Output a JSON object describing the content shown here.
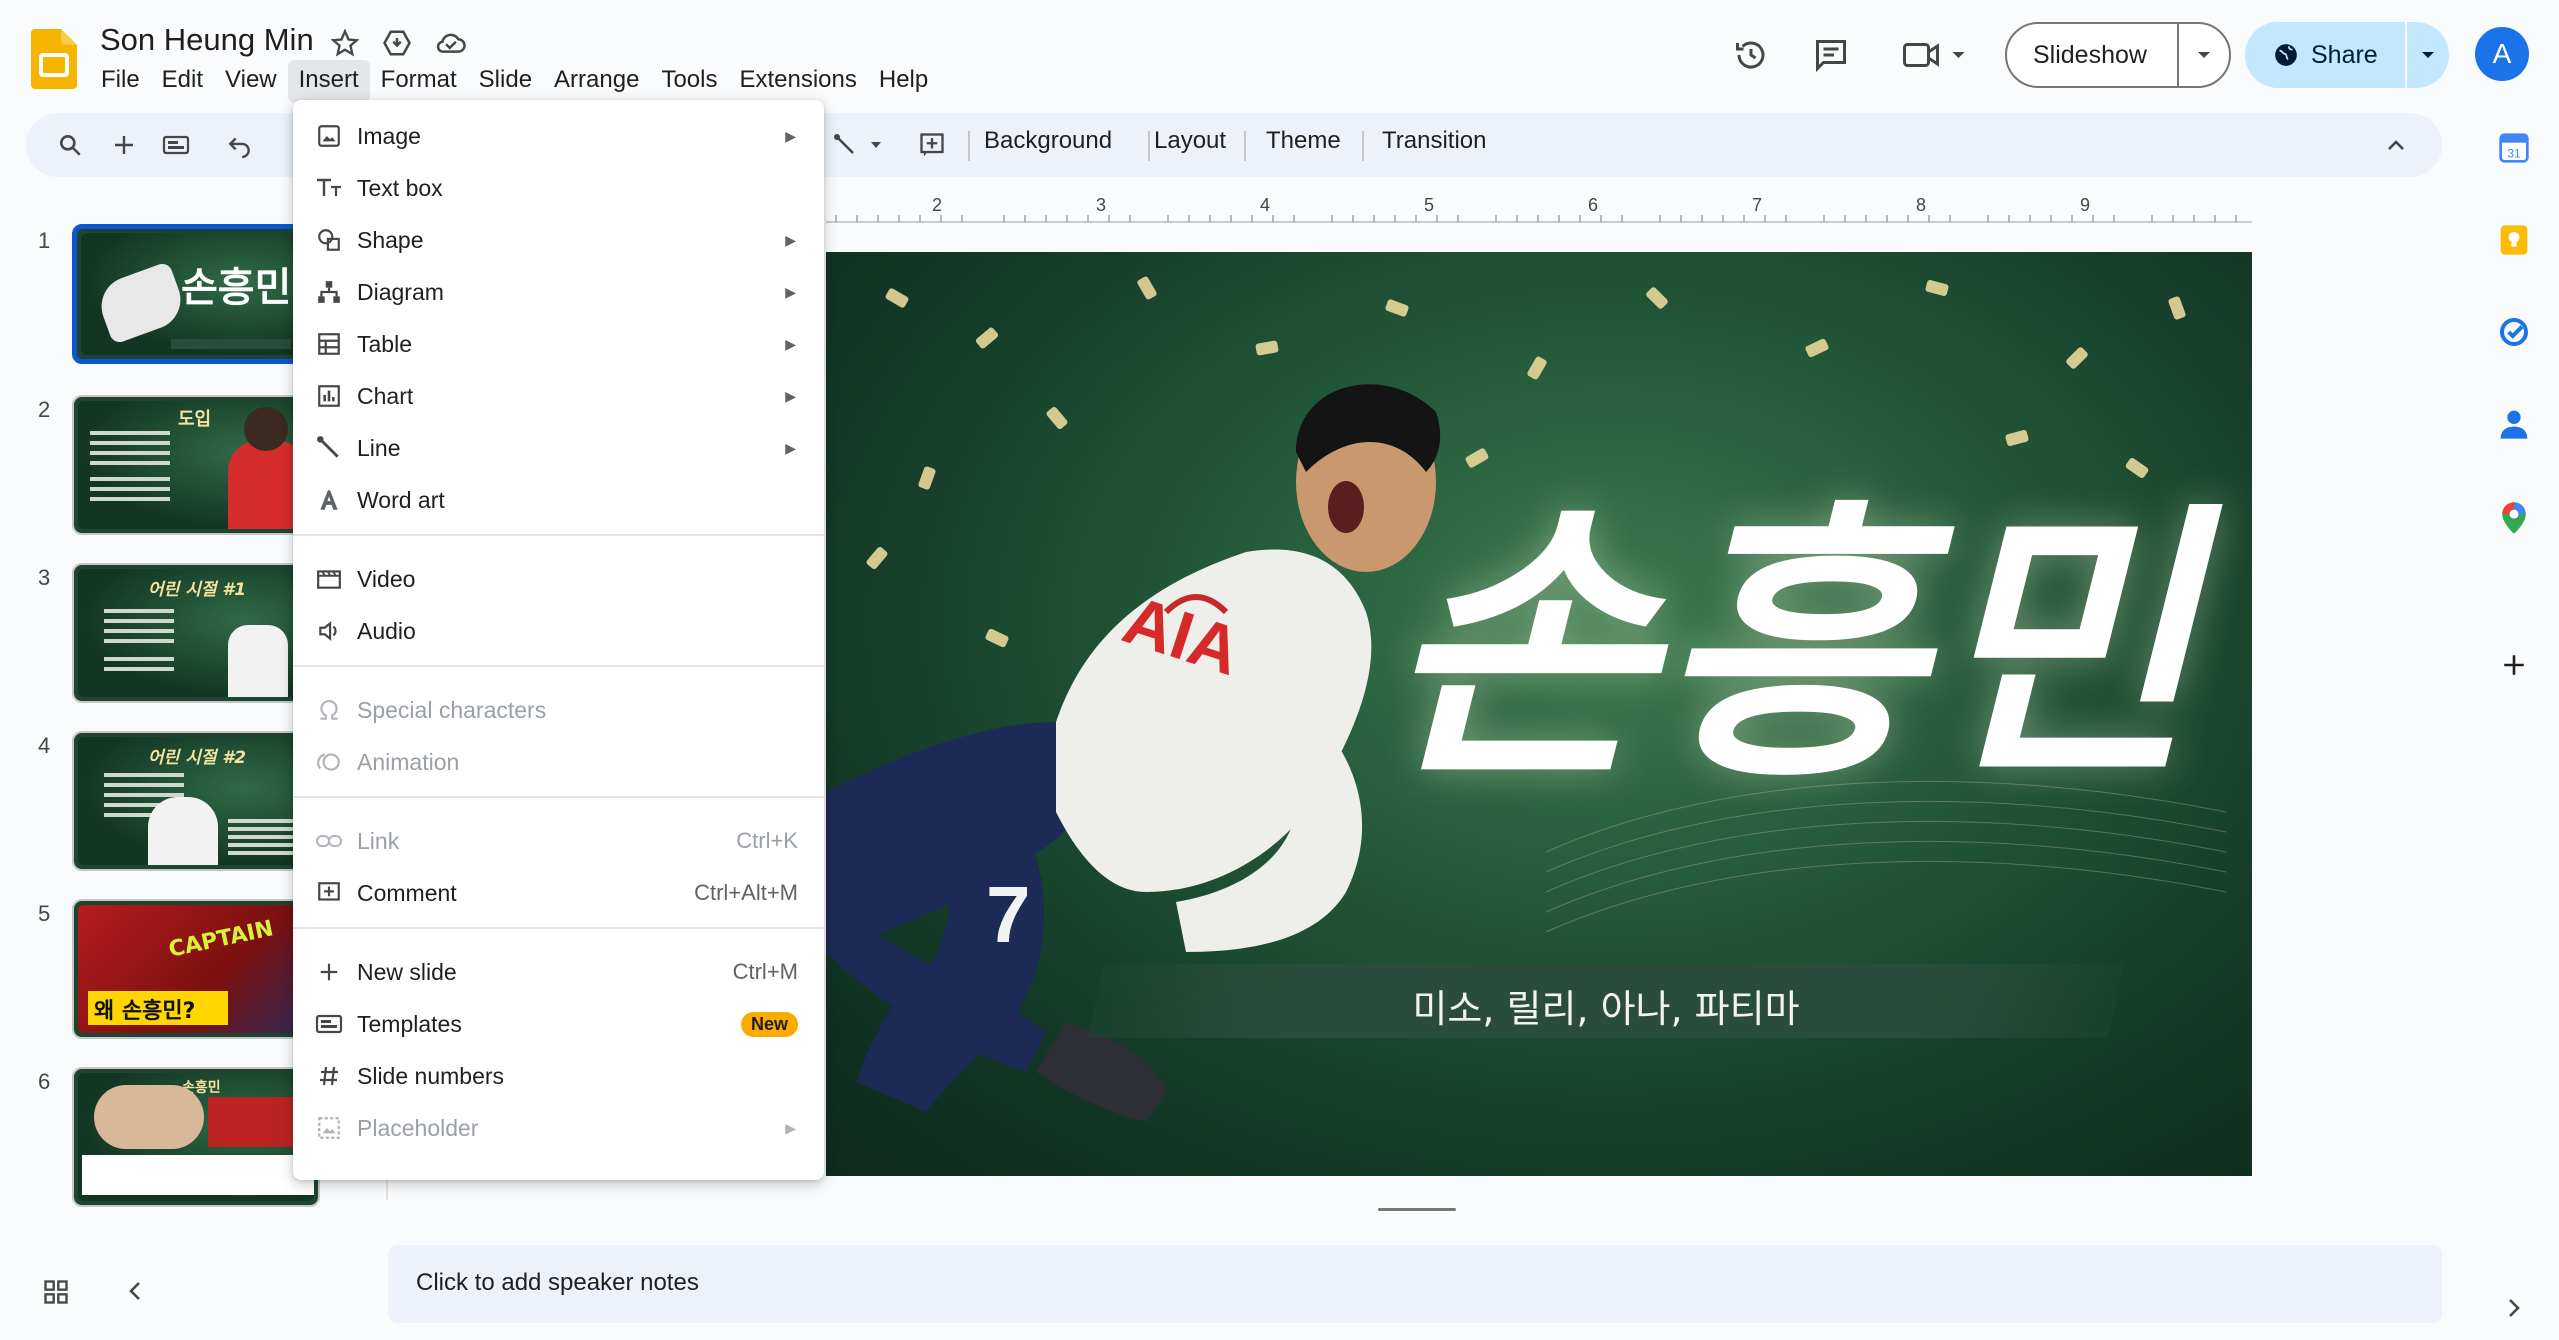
{
  "app": {
    "doc_title": "Son Heung Min",
    "menus": [
      "File",
      "Edit",
      "View",
      "Insert",
      "Format",
      "Slide",
      "Arrange",
      "Tools",
      "Extensions",
      "Help"
    ],
    "active_menu": "Insert"
  },
  "header_buttons": {
    "slideshow": "Slideshow",
    "share": "Share",
    "avatar_letter": "A"
  },
  "toolbar": {
    "background": "Background",
    "layout": "Layout",
    "theme": "Theme",
    "transition": "Transition"
  },
  "insert_menu": {
    "items": [
      {
        "label": "Image",
        "icon": "image-icon",
        "submenu": true,
        "disabled": false
      },
      {
        "label": "Text box",
        "icon": "text-box-icon",
        "submenu": false,
        "disabled": false
      },
      {
        "label": "Shape",
        "icon": "shape-icon",
        "submenu": true,
        "disabled": false
      },
      {
        "label": "Diagram",
        "icon": "diagram-icon",
        "submenu": true,
        "disabled": false
      },
      {
        "label": "Table",
        "icon": "table-icon",
        "submenu": true,
        "disabled": false
      },
      {
        "label": "Chart",
        "icon": "chart-icon",
        "submenu": true,
        "disabled": false
      },
      {
        "label": "Line",
        "icon": "line-icon",
        "submenu": true,
        "disabled": false
      },
      {
        "label": "Word art",
        "icon": "word-art-icon",
        "submenu": false,
        "disabled": false
      },
      {
        "label": "Video",
        "icon": "video-icon",
        "submenu": false,
        "disabled": false
      },
      {
        "label": "Audio",
        "icon": "audio-icon",
        "submenu": false,
        "disabled": false
      },
      {
        "label": "Special characters",
        "icon": "omega-icon",
        "submenu": false,
        "disabled": true
      },
      {
        "label": "Animation",
        "icon": "animation-icon",
        "submenu": false,
        "disabled": true
      },
      {
        "label": "Link",
        "icon": "link-icon",
        "shortcut": "Ctrl+K",
        "submenu": false,
        "disabled": true
      },
      {
        "label": "Comment",
        "icon": "comment-icon",
        "shortcut": "Ctrl+Alt+M",
        "submenu": false,
        "disabled": false
      },
      {
        "label": "New slide",
        "icon": "plus-icon",
        "shortcut": "Ctrl+M",
        "submenu": false,
        "disabled": false
      },
      {
        "label": "Templates",
        "icon": "templates-icon",
        "badge": "New",
        "submenu": false,
        "disabled": false
      },
      {
        "label": "Slide numbers",
        "icon": "hash-icon",
        "submenu": false,
        "disabled": false
      },
      {
        "label": "Placeholder",
        "icon": "placeholder-icon",
        "submenu": true,
        "disabled": true
      }
    ]
  },
  "filmstrip": {
    "slides": [
      {
        "number": "1",
        "heading": "손흥민",
        "selected": true
      },
      {
        "number": "2",
        "heading": "도입",
        "selected": false
      },
      {
        "number": "3",
        "heading": "어린 시절 #1",
        "selected": false
      },
      {
        "number": "4",
        "heading": "어린 시절 #2",
        "selected": false
      },
      {
        "number": "5",
        "heading": "왜 손흥민?",
        "selected": false
      },
      {
        "number": "6",
        "heading": "손흥민",
        "selected": false
      }
    ]
  },
  "ruler": {
    "ticks": [
      "2",
      "3",
      "4",
      "5",
      "6",
      "7",
      "8",
      "9"
    ]
  },
  "slide": {
    "title": "손흥민",
    "subtitle": "미소, 릴리, 아나, 파티마",
    "jersey_sponsor": "AIA",
    "jersey_number": "7"
  },
  "notes": {
    "placeholder": "Click to add speaker notes"
  },
  "colors": {
    "accent_blue": "#0b57d0",
    "share_bg": "#c2e7ff",
    "toolbar_bg": "#edf2fa",
    "badge_new": "#f9ab00",
    "slides_logo": "#f4b400"
  }
}
